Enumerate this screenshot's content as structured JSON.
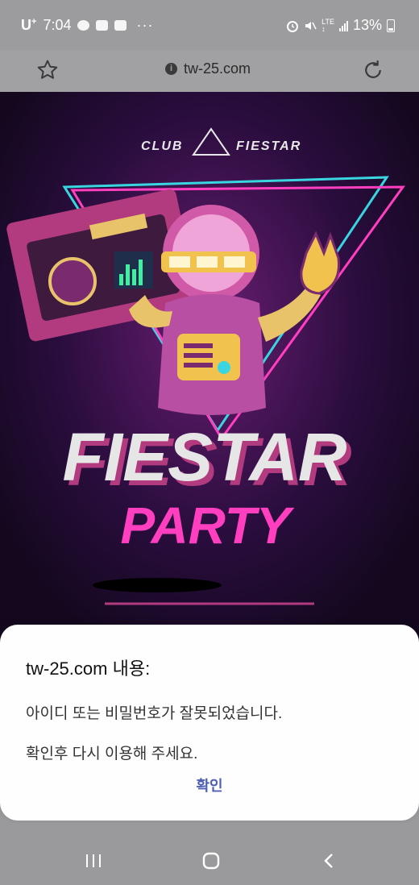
{
  "status": {
    "carrier": "U",
    "carrier_sup": "+",
    "time": "7:04",
    "dots": "···",
    "lte_top": "LTE",
    "lte_bottom": "↕",
    "battery": "13%"
  },
  "browser": {
    "url": "tw-25.com",
    "info_glyph": "i"
  },
  "poster": {
    "club_left": "CLUB",
    "club_right": "FIESTAR",
    "title": "FIESTAR",
    "subtitle": "PARTY"
  },
  "dialog": {
    "title": "tw-25.com 내용:",
    "message_line1": "아이디 또는 비밀번호가 잘못되었습니다.",
    "message_line2": "확인후 다시 이용해 주세요.",
    "ok_label": "확인"
  },
  "colors": {
    "accent": "#4f5fb5",
    "poster_bg": "#1a0a2a",
    "neon_pink": "#ff3fbf",
    "neon_cyan": "#39d5e0"
  }
}
